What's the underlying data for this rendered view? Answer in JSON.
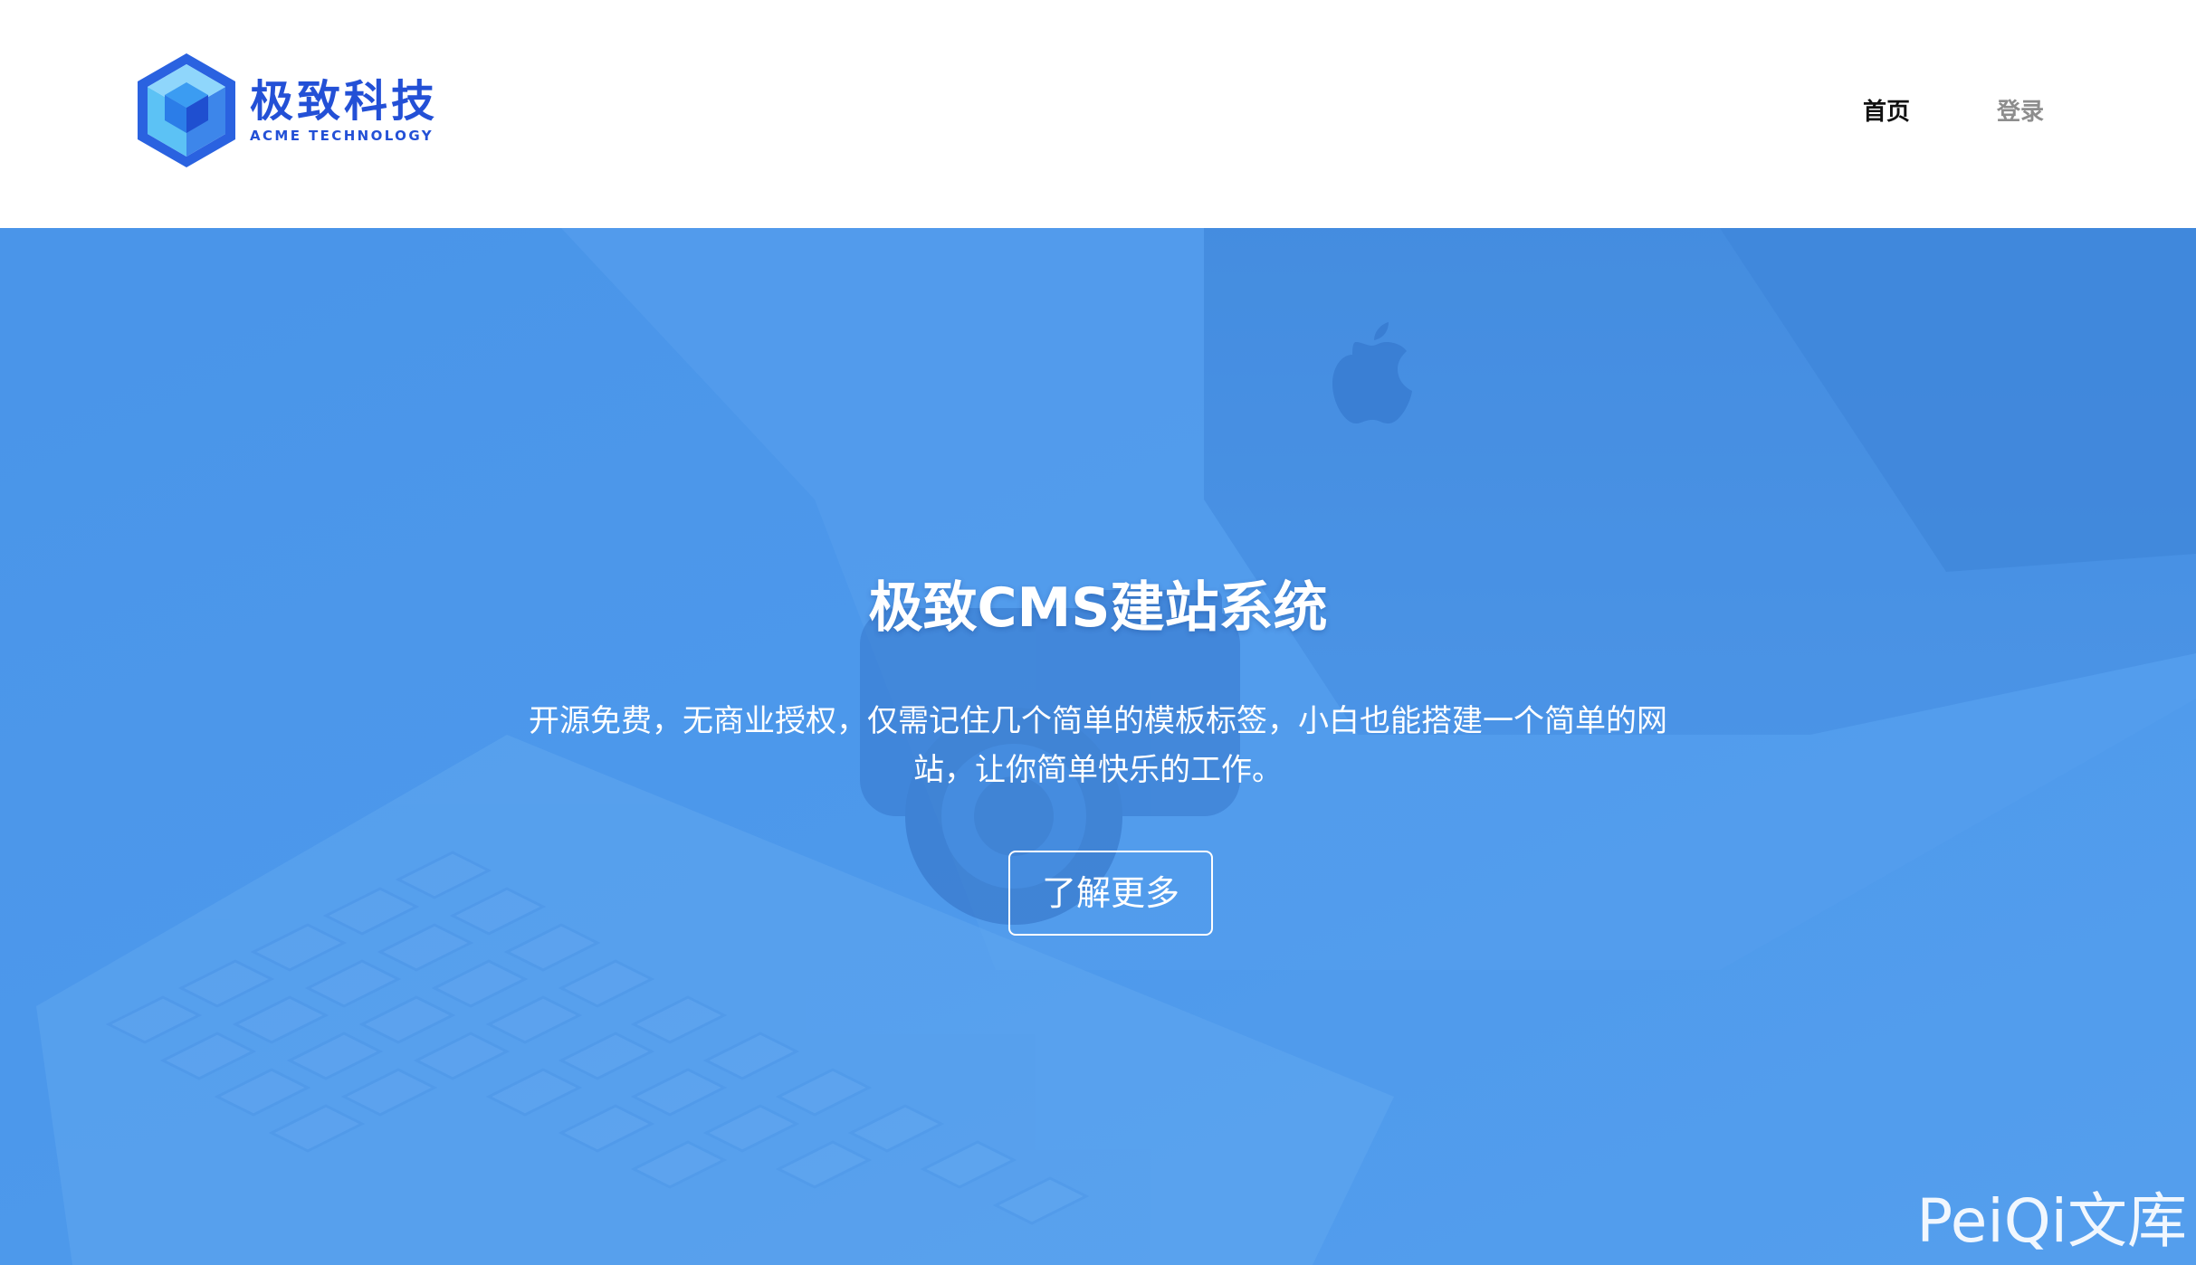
{
  "header": {
    "logo": {
      "name_cn": "极致科技",
      "name_en": "ACME TECHNOLOGY",
      "brand_color": "#2350d6",
      "icon": "cube-logo-icon"
    },
    "nav": [
      {
        "label": "首页",
        "active": true
      },
      {
        "label": "登录",
        "active": false
      }
    ]
  },
  "hero": {
    "background_color": "#4c98ea",
    "background_image": "desk-with-imac-camera-keyboard-photo",
    "title": "极致CMS建站系统",
    "description": "开源免费，无商业授权，仅需记住几个简单的模板标签，小白也能搭建一个简单的网站，让你简单快乐的工作。",
    "button_label": "了解更多"
  },
  "watermark": "PeiQi文库"
}
